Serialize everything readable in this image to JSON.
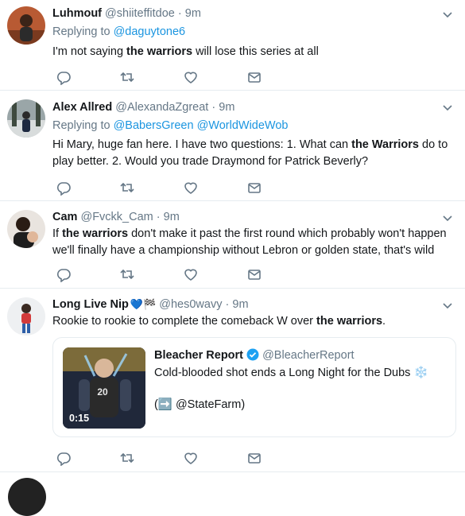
{
  "tweets": [
    {
      "name": "Luhmouf",
      "handle": "@shiiteffitdoe",
      "time": "9m",
      "reply_prefix": "Replying to",
      "reply_to": [
        "@daguytone6"
      ],
      "text_parts": [
        "I'm not saying ",
        "the warriors",
        " will lose this series at all"
      ]
    },
    {
      "name": "Alex Allred",
      "handle": "@AlexandaZgreat",
      "time": "9m",
      "reply_prefix": "Replying to",
      "reply_to": [
        "@BabersGreen",
        "@WorldWideWob"
      ],
      "text_parts": [
        "Hi Mary, huge fan here. I have two questions: 1. What can ",
        "the Warriors",
        " do to play better. 2. Would you trade Draymond for Patrick Beverly?"
      ]
    },
    {
      "name": "Cam",
      "handle": "@Fvckk_Cam",
      "time": "9m",
      "text_parts": [
        "If ",
        "the warriors",
        " don't make it past the first round which probably won't happen we'll finally have a championship without Lebron or golden state, that's wild"
      ]
    },
    {
      "name": "Long Live Nip",
      "name_emoji": "💙🏁",
      "handle": "@hes0wavy",
      "time": "9m",
      "text_parts": [
        "Rookie to rookie to complete the comeback W over ",
        "the warriors",
        "."
      ],
      "quote": {
        "name": "Bleacher Report",
        "handle": "@BleacherReport",
        "text": "Cold-blooded shot ends a Long Night for the Dubs",
        "snowflake": "❄️",
        "mention_prefix": "(",
        "mention_arrow": "➡️",
        "mention": "@StateFarm)",
        "duration": "0:15",
        "jersey": "20"
      }
    }
  ],
  "colors": {
    "link": "#1b95e0",
    "muted": "#657786",
    "text": "#14171a",
    "divider": "#e6ecf0",
    "heart_blue": "#5dadec"
  },
  "icons": [
    "reply-icon",
    "retweet-icon",
    "like-icon",
    "dm-icon",
    "chevron-down-icon",
    "verified-icon",
    "snowflake-icon"
  ]
}
